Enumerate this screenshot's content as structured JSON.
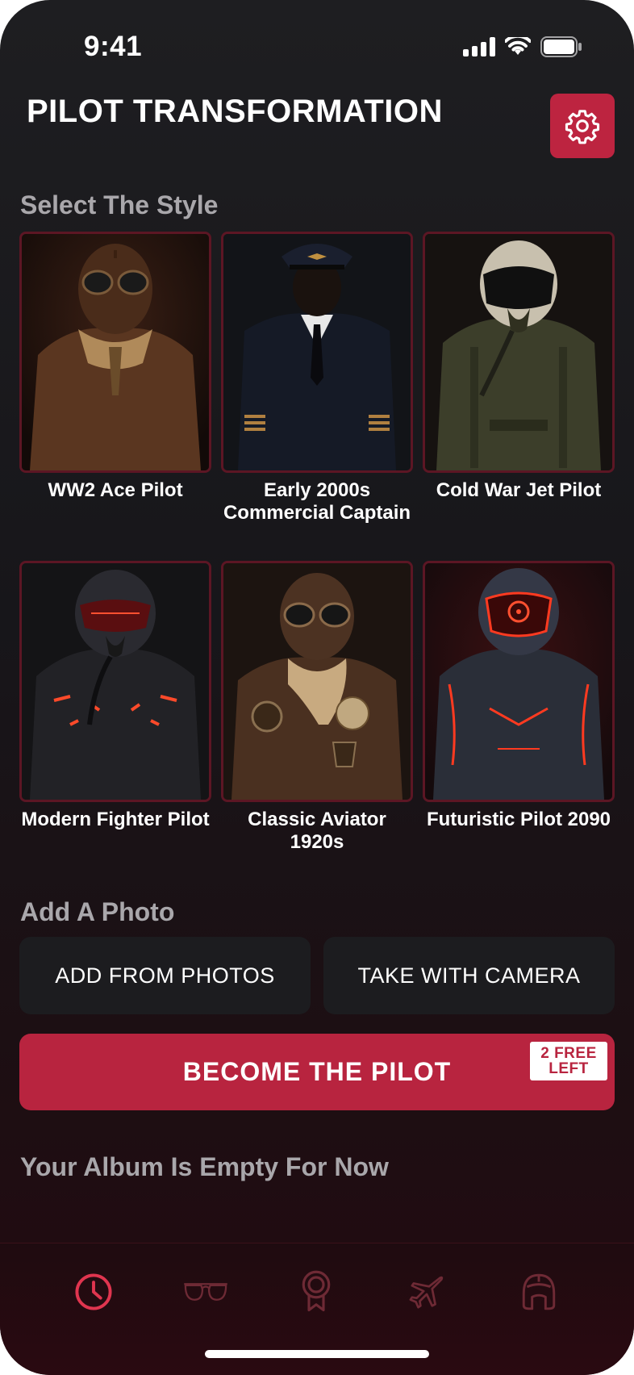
{
  "status_bar": {
    "time": "9:41"
  },
  "header": {
    "title": "PILOT TRANSFORMATION"
  },
  "styles_section": {
    "title": "Select The Style",
    "items": [
      {
        "label": "WW2 Ace Pilot"
      },
      {
        "label": "Early 2000s Commercial Captain"
      },
      {
        "label": "Cold War Jet Pilot"
      },
      {
        "label": "Modern Fighter Pilot"
      },
      {
        "label": "Classic Aviator 1920s"
      },
      {
        "label": "Futuristic Pilot 2090"
      }
    ]
  },
  "photo_section": {
    "title": "Add A Photo",
    "add_from_photos": "ADD FROM PHOTOS",
    "take_with_camera": "TAKE WITH CAMERA"
  },
  "cta": {
    "label": "BECOME THE PILOT",
    "badge": "2 FREE LEFT"
  },
  "album": {
    "empty_text": "Your Album Is Empty For Now"
  },
  "tab_bar": {
    "items": [
      {
        "icon": "clock-icon",
        "active": true
      },
      {
        "icon": "aviator-sunglasses-icon",
        "active": false
      },
      {
        "icon": "award-medal-icon",
        "active": false
      },
      {
        "icon": "airplane-icon",
        "active": false
      },
      {
        "icon": "pilot-helmet-icon",
        "active": false
      }
    ]
  },
  "colors": {
    "accent": "#bd2440",
    "tab_active": "#e0354f",
    "tab_inactive": "#6e2a35"
  }
}
